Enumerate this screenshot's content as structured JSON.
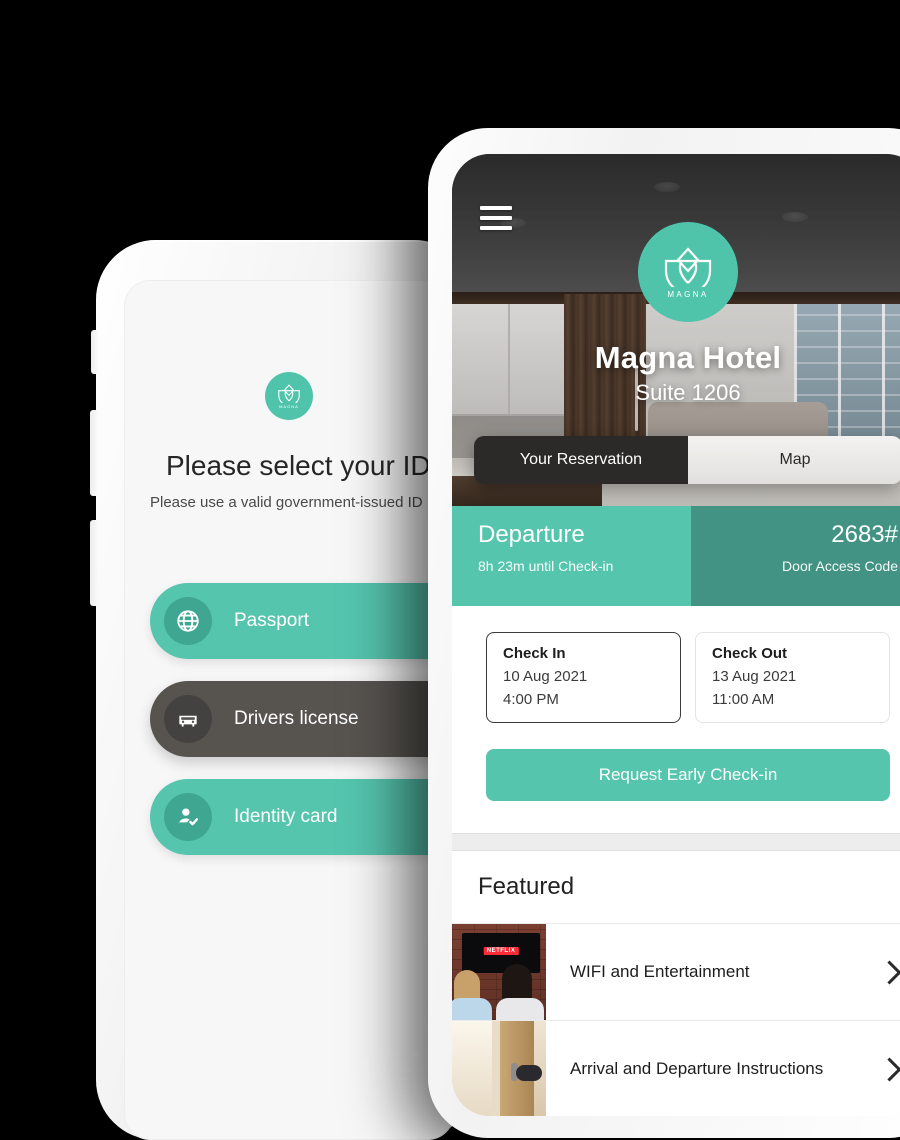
{
  "left_phone": {
    "logo": {
      "word": "MAGNA",
      "icon": "magna-lotus-logo"
    },
    "heading": "Please select your ID type",
    "subheading": "Please use a valid government-issued ID",
    "options": [
      {
        "label": "Passport",
        "icon": "globe-icon",
        "state": "default"
      },
      {
        "label": "Drivers license",
        "icon": "car-icon",
        "state": "selected"
      },
      {
        "label": "Identity card",
        "icon": "person-check-icon",
        "state": "default"
      }
    ]
  },
  "right_phone": {
    "hero": {
      "menu_icon": "hamburger-menu-icon",
      "logo_word": "MAGNA",
      "logo_icon": "magna-lotus-logo",
      "hotel_name": "Magna Hotel",
      "suite": "Suite 1206"
    },
    "tabs": [
      {
        "label": "Your Reservation",
        "active": true
      },
      {
        "label": "Map",
        "active": false
      }
    ],
    "status_strip": {
      "left_title": "Departure",
      "left_sub": "8h 23m until Check-in",
      "right_title": "2683#",
      "right_sub": "Door Access Code"
    },
    "reservation": {
      "check_in": {
        "label": "Check In",
        "date": "10 Aug 2021",
        "time": "4:00 PM"
      },
      "check_out": {
        "label": "Check Out",
        "date": "13 Aug 2021",
        "time": "11:00 AM"
      },
      "cta_label": "Request Early Check-in"
    },
    "featured": {
      "title": "Featured",
      "items": [
        {
          "label": "WIFI and Entertainment",
          "thumb": "tv-netflix-photo",
          "chevron": "chevron-right-icon"
        },
        {
          "label": "Arrival and Departure Instructions",
          "thumb": "hotel-door-photo",
          "chevron": "chevron-right-icon"
        }
      ]
    }
  },
  "colors": {
    "teal": "#55c5ae",
    "teal_dark": "#429384",
    "teal_logo": "#4fc4ab",
    "tab_active_bg": "#2b2a29",
    "option_selected_bg": "#575450",
    "page_bg": "#000000"
  }
}
